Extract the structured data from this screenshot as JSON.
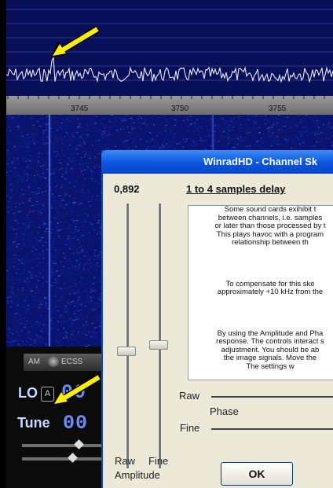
{
  "spectrum": {
    "frequency_labels": [
      "3745",
      "3750",
      "3755"
    ]
  },
  "receiver": {
    "mode_am": "AM",
    "mode_ecss": "ECSS",
    "lo_label": "LO",
    "lo_badge": "A",
    "lo_digits": "00",
    "tune_label": "Tune",
    "tune_digits": "00"
  },
  "dialog": {
    "title": "WinradHD - Channel Sk",
    "amplitude_value": "0,892",
    "delay_link": "1 to 4 samples delay",
    "info_lines": [
      "Some sound cards exihibit t",
      "between channels, i.e. samples",
      "or later than those processed by t",
      "This plays havoc with a program",
      "relationship between th",
      "",
      "To compensate for this ske",
      "approximately +10 kHz from the",
      "",
      "By using the Amplitude and Pha",
      "response. The controls interact s",
      "adjustment. You should be ab",
      "the image signals. Move the",
      "The settings w"
    ],
    "raw_label": "Raw",
    "phase_label": "Phase",
    "fine_label": "Fine",
    "slider_raw_label": "Raw",
    "slider_fine_label": "Fine",
    "amplitude_label": "Amplitude",
    "ok_label": "OK"
  },
  "colors": {
    "spectrum_bg": "#0a0f5a",
    "waterfall_bg": "#0a1470",
    "titlebar": "#0a55e0",
    "dialog_bg": "#ece9d8",
    "arrow": "#ffee00"
  }
}
